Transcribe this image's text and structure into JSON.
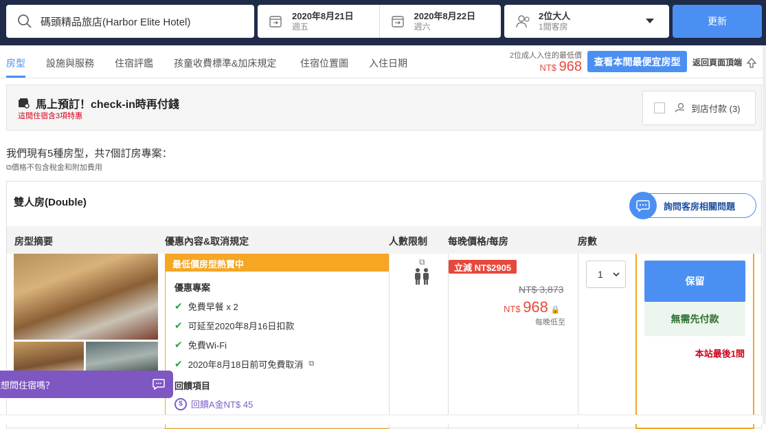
{
  "search": {
    "hotel_name": "碼頭精品旅店(Harbor Elite Hotel)"
  },
  "dates": {
    "checkin_date": "2020年8月21日",
    "checkin_day": "週五",
    "checkout_date": "2020年8月22日",
    "checkout_day": "週六"
  },
  "guests": {
    "adults": "2位大人",
    "rooms": "1間客房"
  },
  "update_label": "更新",
  "nav": {
    "tabs": [
      "房型",
      "設施與服務",
      "住宿評鑑",
      "孩童收費標準&加床規定",
      "住宿位置圖",
      "入住日期"
    ]
  },
  "lowest": {
    "label": "2位成人入住的最低價",
    "currency": "NT$",
    "price": "968"
  },
  "cheapest_button": "查看本間最便宜房型",
  "back_to_top": "返回頁面頂端",
  "promo": {
    "title": "馬上預訂！check-in時再付錢",
    "subtitle": "這間住宿含3項特惠",
    "pay_at_store": "到店付款 (3)"
  },
  "summary": {
    "text": "我們現有5種房型，共7個訂房專案：",
    "note": "價格不包含稅金和附加費用"
  },
  "room": {
    "title": "雙人房(Double)",
    "ask_label": "詢問客房相關問題",
    "headers": [
      "房型摘要",
      "優惠內容&取消規定",
      "人數限制",
      "每晚價格/每房",
      "房數"
    ],
    "offer_head": "最低價房型熱賣中",
    "offer_section": "優惠專案",
    "perks": [
      "免費早餐 x 2",
      "可延至2020年8月16日扣款",
      "免費Wi-Fi",
      "2020年8月18日前可免費取消"
    ],
    "refund_section": "回饋項目",
    "refund_text": "回饋A金NT$ 45",
    "sale_badge": "立減 NT$2905",
    "original_price": "NT$ 3,873",
    "price_currency": "NT$",
    "price": "968",
    "price_note": "每晚低至",
    "qty": "1",
    "reserve_label": "保留",
    "no_prepay": "無需先付款",
    "last_room": "本站最後1間"
  },
  "chat": {
    "text": "還想問住宿嗎？"
  }
}
